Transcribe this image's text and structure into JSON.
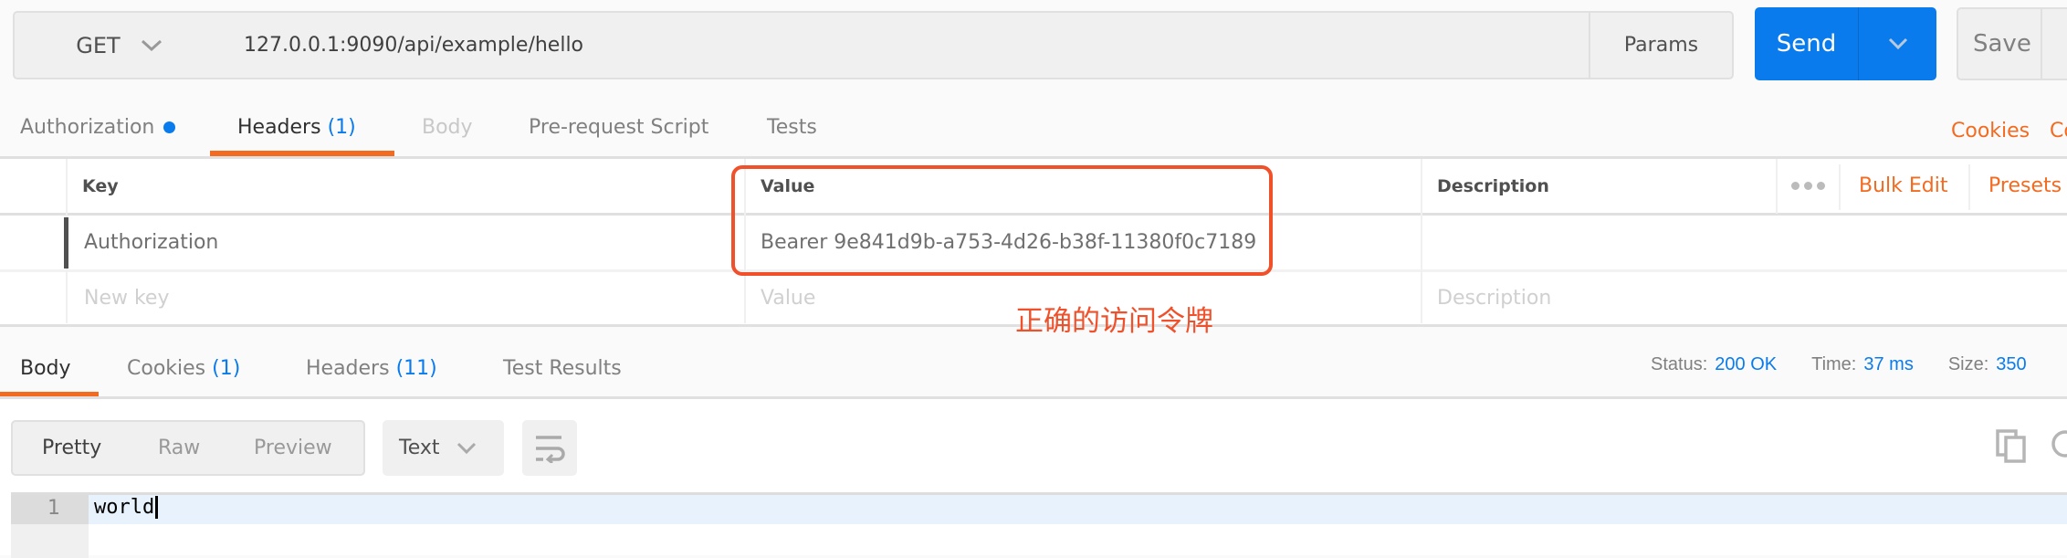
{
  "request": {
    "method": "GET",
    "url": "127.0.0.1:9090/api/example/hello",
    "params_label": "Params",
    "send_label": "Send",
    "save_label": "Save"
  },
  "request_tabs": [
    {
      "label": "Authorization",
      "indicator": "dot"
    },
    {
      "label": "Headers",
      "count": "(1)",
      "active": true
    },
    {
      "label": "Body",
      "disabled": true
    },
    {
      "label": "Pre-request Script"
    },
    {
      "label": "Tests"
    }
  ],
  "links": {
    "cookies": "Cookies",
    "code": "Co"
  },
  "headers_table": {
    "columns": [
      "Key",
      "Value",
      "Description"
    ],
    "more_icon": "ellipsis-icon",
    "bulk_edit": "Bulk Edit",
    "presets": "Presets",
    "rows": [
      {
        "key": "Authorization",
        "value": "Bearer 9e841d9b-a753-4d26-b38f-11380f0c7189",
        "description": ""
      }
    ],
    "placeholder": {
      "key": "New key",
      "value": "Value",
      "description": "Description"
    }
  },
  "annotation": {
    "text": "正确的访问令牌",
    "color": "#f0502a"
  },
  "response_tabs": [
    {
      "label": "Body",
      "active": true
    },
    {
      "label": "Cookies",
      "count": "(1)"
    },
    {
      "label": "Headers",
      "count": "(11)"
    },
    {
      "label": "Test Results"
    }
  ],
  "response_meta": {
    "status_label": "Status:",
    "status": "200 OK",
    "time_label": "Time:",
    "time": "37 ms",
    "size_label": "Size:",
    "size": "350"
  },
  "view_modes": [
    "Pretty",
    "Raw",
    "Preview"
  ],
  "format": "Text",
  "editor": {
    "lines": [
      {
        "number": "1",
        "text": "world"
      }
    ]
  },
  "colors": {
    "accent": "#f26b21",
    "send": "#097bed",
    "link": "#097bed"
  }
}
